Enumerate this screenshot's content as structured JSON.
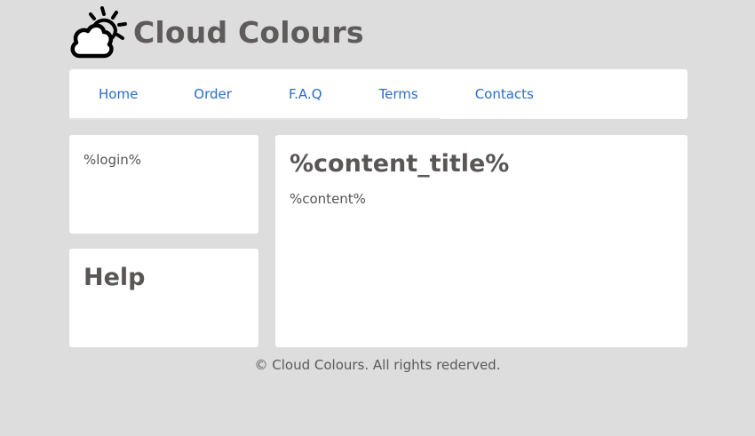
{
  "header": {
    "logo_icon": "cloud-sun-icon",
    "title": "Cloud Colours"
  },
  "nav": {
    "items": [
      {
        "label": "Home"
      },
      {
        "label": "Order"
      },
      {
        "label": "F.A.Q"
      },
      {
        "label": "Terms"
      },
      {
        "label": "Contacts"
      }
    ]
  },
  "sidebar": {
    "login_placeholder": "%login%",
    "help_title": "Help"
  },
  "main": {
    "content_title": "%content_title%",
    "content": "%content%"
  },
  "footer": {
    "text": "© Cloud Colours. All rights rederved."
  },
  "colors": {
    "background": "#dddddd",
    "panel": "#ffffff",
    "link": "#2b6cc4",
    "heading": "#5a5656"
  }
}
